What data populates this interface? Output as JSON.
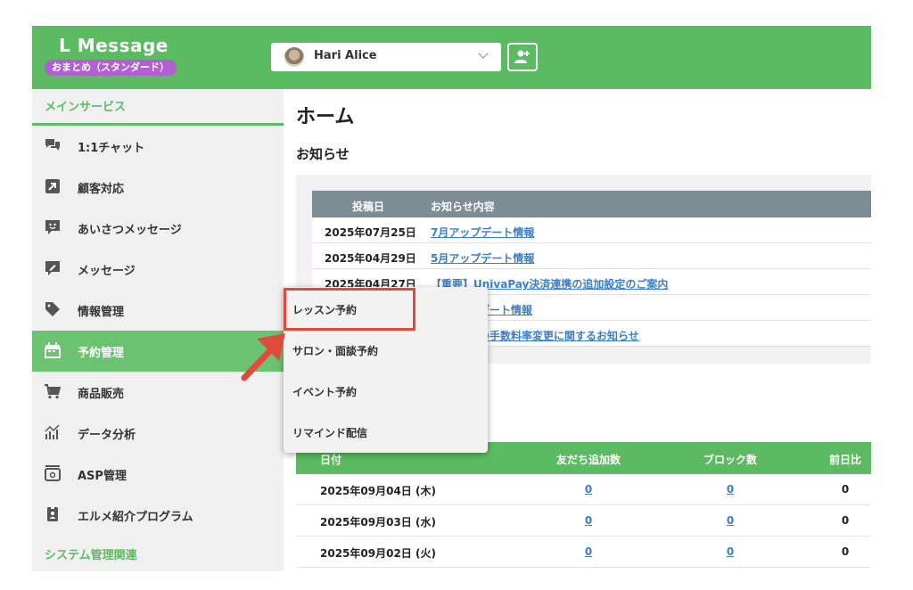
{
  "header": {
    "brand": "L Message",
    "plan": "おまとめ（スタンダード）",
    "account_name": "Hari Alice"
  },
  "sidebar": {
    "section_main": "メインサービス",
    "items": [
      {
        "label": "1:1チャット",
        "icon": "chat-icon"
      },
      {
        "label": "顧客対応",
        "icon": "external-arrow-icon"
      },
      {
        "label": "あいさつメッセージ",
        "icon": "greeting-message-icon"
      },
      {
        "label": "メッセージ",
        "icon": "message-pen-icon"
      },
      {
        "label": "情報管理",
        "icon": "tag-icon"
      },
      {
        "label": "予約管理",
        "icon": "calendar-icon",
        "active": true
      },
      {
        "label": "商品販売",
        "icon": "cart-icon"
      },
      {
        "label": "データ分析",
        "icon": "chart-icon"
      },
      {
        "label": "ASP管理",
        "icon": "asp-box-icon"
      },
      {
        "label": "エルメ紹介プログラム",
        "icon": "id-badge-icon"
      }
    ],
    "section_system": "システム管理関連"
  },
  "main": {
    "title": "ホーム",
    "news_heading": "お知らせ",
    "news_columns": [
      "投稿日",
      "お知らせ内容"
    ],
    "news": [
      {
        "date": "2025年07月25日",
        "text": "7月アップデート情報"
      },
      {
        "date": "2025年04月29日",
        "text": "5月アップデート情報"
      },
      {
        "date": "2025年04月27日",
        "text": "【重要】UnivaPay決済連携の追加設定のご案内"
      },
      {
        "date": "",
        "text": "デート情報"
      },
      {
        "date": "",
        "text": "の手数料率変更に関するお知らせ"
      }
    ],
    "stats_columns": [
      "日付",
      "友だち追加数",
      "ブロック数",
      "前日比"
    ],
    "stats": [
      {
        "date": "2025年09月04日 (木)",
        "friends": "0",
        "blocks": "0",
        "diff": "0"
      },
      {
        "date": "2025年09月03日 (水)",
        "friends": "0",
        "blocks": "0",
        "diff": "0"
      },
      {
        "date": "2025年09月02日 (火)",
        "friends": "0",
        "blocks": "0",
        "diff": "0"
      }
    ]
  },
  "dropdown": {
    "items": [
      "レッスン予約",
      "サロン・面談予約",
      "イベント予約",
      "リマインド配信"
    ]
  },
  "colors": {
    "brand_green": "#5cbb62",
    "active_green": "#6bc371",
    "plan_purple": "#b25fd4",
    "link_blue": "#3b7ec9",
    "highlight_red": "#e04a3a"
  }
}
